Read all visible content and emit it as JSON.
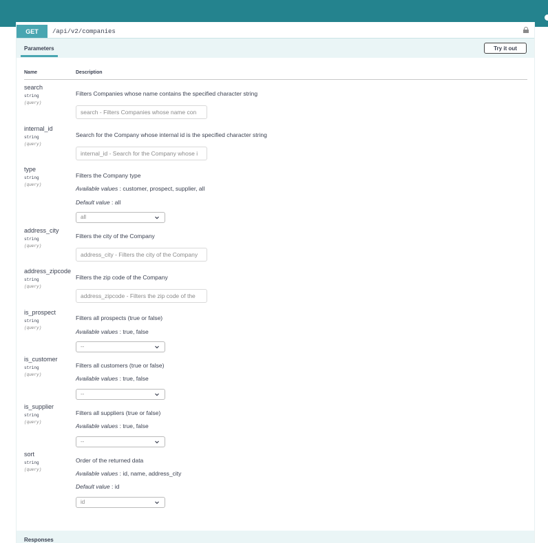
{
  "operation": {
    "method": "GET",
    "path": "/api/v2/companies"
  },
  "tabs": {
    "parameters_label": "Parameters",
    "try_label": "Try it out"
  },
  "table": {
    "col_name": "Name",
    "col_description": "Description"
  },
  "params": [
    {
      "name": "search",
      "type": "string",
      "in": "(query)",
      "description": "Filters Companies whose name contains the specified character string",
      "placeholder": "search - Filters Companies whose name con"
    },
    {
      "name": "internal_id",
      "type": "string",
      "in": "(query)",
      "description": "Search for the Company whose internal id is the specified character string",
      "placeholder": "internal_id - Search for the Company whose i"
    },
    {
      "name": "type",
      "type": "string",
      "in": "(query)",
      "description": "Filters the Company type",
      "available_label": "Available values",
      "available": " : customer, prospect, supplier, all",
      "default_label": "Default value",
      "default": " : all",
      "selected": "all"
    },
    {
      "name": "address_city",
      "type": "string",
      "in": "(query)",
      "description": "Filters the city of the Company",
      "placeholder": "address_city - Filters the city of the Company"
    },
    {
      "name": "address_zipcode",
      "type": "string",
      "in": "(query)",
      "description": "Filters the zip code of the Company",
      "placeholder": "address_zipcode - Filters the zip code of the"
    },
    {
      "name": "is_prospect",
      "type": "string",
      "in": "(query)",
      "description": "Filters all prospects (true or false)",
      "available_label": "Available values",
      "available": " : true, false",
      "selected": "--"
    },
    {
      "name": "is_customer",
      "type": "string",
      "in": "(query)",
      "description": "Filters all customers (true or false)",
      "available_label": "Available values",
      "available": " : true, false",
      "selected": "--"
    },
    {
      "name": "is_supplier",
      "type": "string",
      "in": "(query)",
      "description": "Filters all suppliers (true or false)",
      "available_label": "Available values",
      "available": " : true, false",
      "selected": "--"
    },
    {
      "name": "sort",
      "type": "string",
      "in": "(query)",
      "description": "Order of the returned data",
      "available_label": "Available values",
      "available": " : id, name, address_city",
      "default_label": "Default value",
      "default": " : id",
      "selected": "id"
    }
  ],
  "responses_label": "Responses",
  "icons": {
    "lock": "lock-icon",
    "chevron": "chevron-down-icon"
  },
  "colors": {
    "topbar": "#24838e",
    "method": "#49a6b1",
    "section_bg": "#eaf5f6"
  }
}
